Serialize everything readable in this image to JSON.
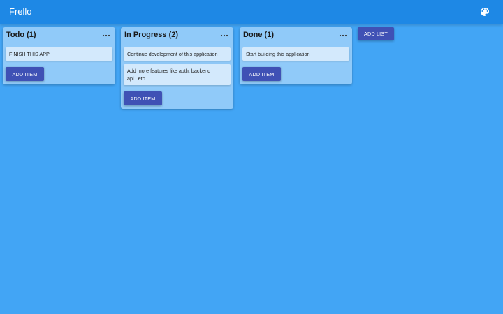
{
  "app": {
    "title": "Frello",
    "palette_icon": "palette-icon"
  },
  "colors": {
    "appbar": "#1e88e5",
    "background": "#42a5f5",
    "list_bg": "#90caf9",
    "card_bg": "#d3e9fc",
    "button": "#3f51b5"
  },
  "lists": [
    {
      "title": "Todo (1)",
      "menu_icon": "more-horizontal-icon",
      "cards": [
        "FINISH THIS APP"
      ],
      "add_item_label": "ADD ITEM"
    },
    {
      "title": "In Progress (2)",
      "menu_icon": "more-horizontal-icon",
      "cards": [
        "Continue development of this application",
        "Add more features like auth, backend api...etc."
      ],
      "add_item_label": "ADD ITEM"
    },
    {
      "title": "Done (1)",
      "menu_icon": "more-horizontal-icon",
      "cards": [
        "Start building this application"
      ],
      "add_item_label": "ADD ITEM"
    }
  ],
  "add_list_label": "ADD LIST"
}
